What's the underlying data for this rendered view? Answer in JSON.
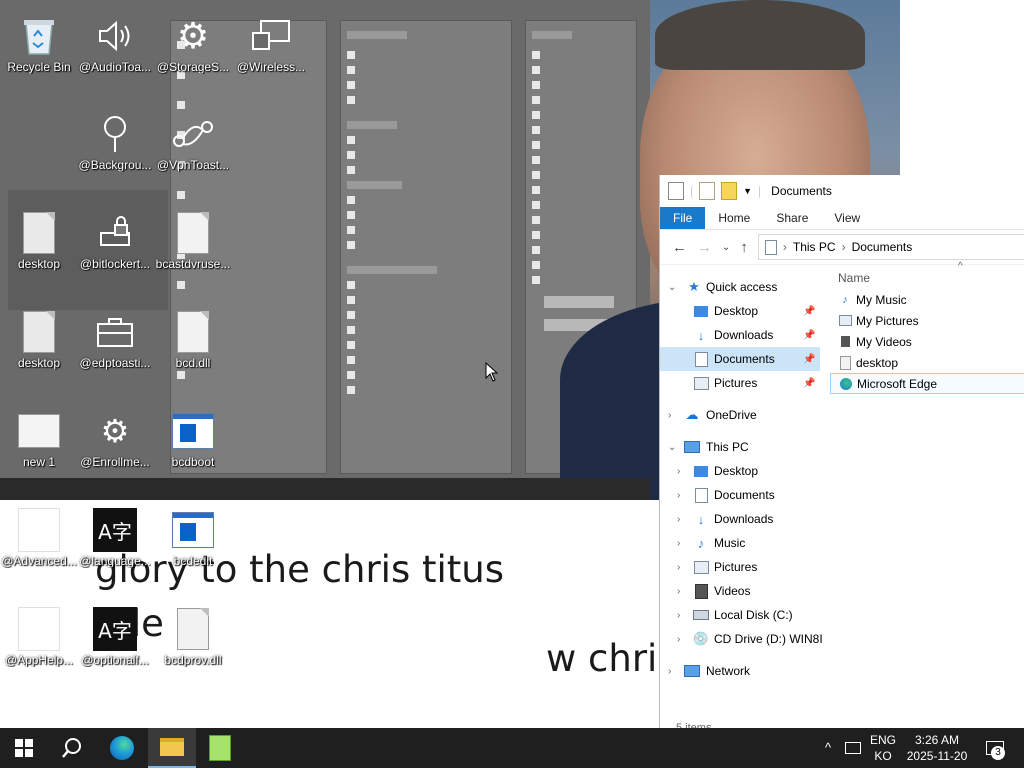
{
  "desktop": {
    "icons": [
      {
        "label": "Recycle Bin",
        "icon": "recycle-bin-icon"
      },
      {
        "label": "@AudioToa...",
        "icon": "speaker-icon"
      },
      {
        "label": "@StorageS...",
        "icon": "gear-icon"
      },
      {
        "label": "@Wireless...",
        "icon": "cast-display-icon"
      },
      {
        "label": "@Backgrou...",
        "icon": "location-pin-icon"
      },
      {
        "label": "@VpnToast...",
        "icon": "vpn-link-icon"
      },
      {
        "label": "desktop",
        "icon": "settings-file-icon"
      },
      {
        "label": "@bitlockert...",
        "icon": "lock-drive-icon"
      },
      {
        "label": "bcastdvruse...",
        "icon": "settings-file-icon"
      },
      {
        "label": "desktop",
        "icon": "settings-file-icon"
      },
      {
        "label": "@edptoasti...",
        "icon": "briefcase-icon"
      },
      {
        "label": "bcd.dll",
        "icon": "settings-file-icon"
      },
      {
        "label": "new 1",
        "icon": "settings-window-icon"
      },
      {
        "label": "@Enrollme...",
        "icon": "gear-icon"
      },
      {
        "label": "bcdboot",
        "icon": "app-window-icon"
      },
      {
        "label": "@Advanced...",
        "icon": "blank-file-icon"
      },
      {
        "label": "@language...",
        "icon": "language-icon"
      },
      {
        "label": "bcdedit",
        "icon": "app-window-icon"
      },
      {
        "label": "@AppHelp...",
        "icon": "blank-file-icon"
      },
      {
        "label": "@optionalf...",
        "icon": "language-icon"
      },
      {
        "label": "bcdprov.dll",
        "icon": "settings-file-icon"
      }
    ],
    "language_glyph": "A字"
  },
  "subtitles": {
    "line1": "glory to the chris titus",
    "line2": "ade",
    "line3": "w chris"
  },
  "explorer": {
    "title": "Documents",
    "ribbon_tabs": [
      "File",
      "Home",
      "Share",
      "View"
    ],
    "breadcrumb": [
      "This PC",
      "Documents"
    ],
    "column_name": "Name",
    "quick_access": {
      "label": "Quick access",
      "items": [
        "Desktop",
        "Downloads",
        "Documents",
        "Pictures"
      ]
    },
    "onedrive": "OneDrive",
    "this_pc": {
      "label": "This PC",
      "items": [
        "Desktop",
        "Documents",
        "Downloads",
        "Music",
        "Pictures",
        "Videos",
        "Local Disk (C:)",
        "CD Drive (D:) WIN8I"
      ]
    },
    "network": "Network",
    "files": [
      "My Music",
      "My Pictures",
      "My Videos",
      "desktop",
      "Microsoft Edge"
    ],
    "status": "5 items"
  },
  "taskbar": {
    "lang_top": "ENG",
    "lang_bottom": "KO",
    "time": "3:26 AM",
    "date": "2025-11-20",
    "notification_count": "3",
    "colors": {
      "bar": "#1f1f1f",
      "accent": "#76b9ed"
    }
  }
}
